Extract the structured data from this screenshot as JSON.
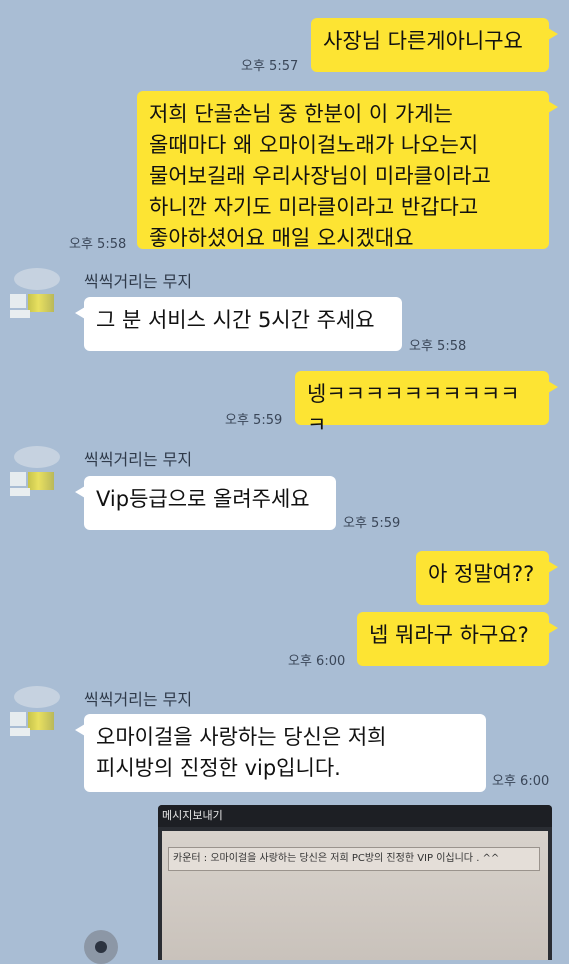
{
  "messages": [
    {
      "id": "m1",
      "side": "me",
      "text": "사장님 다른게아니구요",
      "time": "오후 5:57"
    },
    {
      "id": "m2",
      "side": "me",
      "lines": [
        "저희 단골손님 중 한분이 이 가게는",
        "올때마다 왜 오마이걸노래가 나오는지",
        "물어보길래 우리사장님이 미라클이라고",
        "하니깐 자기도 미라클이라고 반갑다고",
        "좋아하셨어요 매일 오시겠대요"
      ],
      "time": "오후 5:58"
    },
    {
      "id": "m3",
      "side": "other",
      "sender": "씩씩거리는 무지",
      "text": "그 분 서비스 시간 5시간 주세요",
      "time": "오후 5:58"
    },
    {
      "id": "m4",
      "side": "me",
      "text": "넹ㅋㅋㅋㅋㅋㅋㅋㅋㅋㅋㅋ",
      "time": "오후 5:59"
    },
    {
      "id": "m5",
      "side": "other",
      "sender": "씩씩거리는 무지",
      "text": "Vip등급으로 올려주세요",
      "time": "오후 5:59"
    },
    {
      "id": "m6",
      "side": "me",
      "text": "아 정말여??"
    },
    {
      "id": "m7",
      "side": "me",
      "text": "넵 뭐라구 하구요?",
      "time": "오후 6:00"
    },
    {
      "id": "m8",
      "side": "other",
      "sender": "씩씩거리는 무지",
      "lines": [
        "오마이걸을 사랑하는 당신은 저희",
        "피시방의 진정한 vip입니다."
      ],
      "time": "오후 6:00"
    }
  ],
  "photo": {
    "title": "메시지보내기",
    "text": "카운터 : 오마이걸을 사랑하는 당신은 저희 PC방의 진정한 VIP 이십니다 . ^^"
  },
  "colors": {
    "background": "#a9bdd4",
    "my_bubble": "#fde433",
    "other_bubble": "#ffffff"
  }
}
